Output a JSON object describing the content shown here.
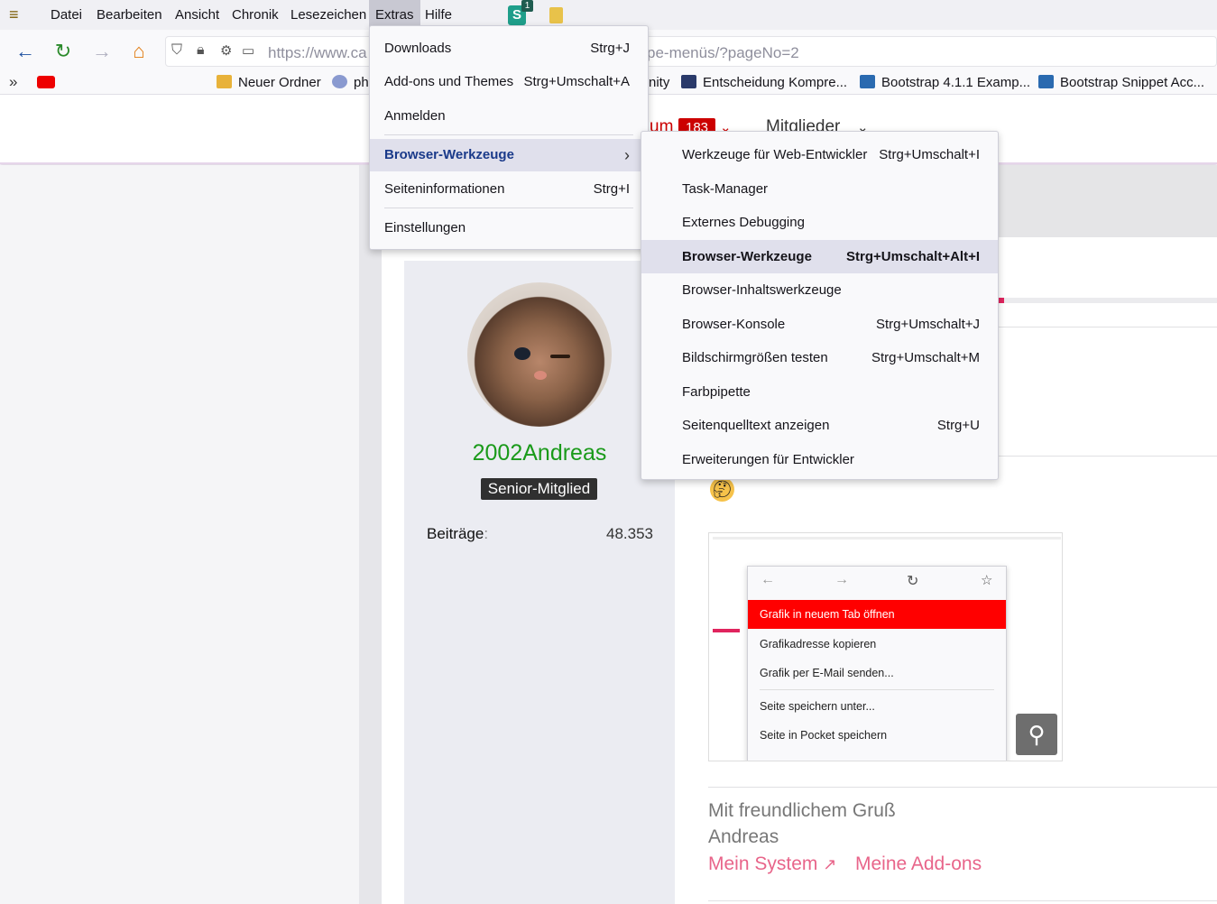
{
  "menubar": {
    "items": [
      "Datei",
      "Bearbeiten",
      "Ansicht",
      "Chronik",
      "Lesezeichen",
      "Extras",
      "Hilfe"
    ],
    "badge": "1"
  },
  "navbar": {
    "url": "https://www.ca",
    "url_tail": "pe-menüs/?pageNo=2"
  },
  "bookmarks": [
    {
      "label": "Neuer Ordner",
      "icon": "folder-icon",
      "color": "#e8b23a"
    },
    {
      "label": "ph",
      "icon": "people-icon",
      "color": "#5a6aa0"
    },
    {
      "label": "nity",
      "icon": "",
      "color": ""
    },
    {
      "label": "Entscheidung Kompre...",
      "icon": "chart-icon",
      "color": "#2a3a6a"
    },
    {
      "label": "Bootstrap 4.1.1 Examp...",
      "icon": "bootstrap-icon",
      "color": "#2a6ab0"
    },
    {
      "label": "Bootstrap Snippet Acc...",
      "icon": "bootstrap-icon",
      "color": "#2a6ab0"
    }
  ],
  "page": {
    "nav_badge": "183",
    "nav_item": "Mitglieder",
    "nav_prev": "um"
  },
  "user": {
    "name": "2002Andreas",
    "rank": "Senior-Mitglied",
    "posts_label": "Beiträge",
    "posts_sep": ":",
    "posts_value": "48.353"
  },
  "screenshot_menu": {
    "items": [
      "Grafik in neuem Tab öffnen",
      "Grafikadresse kopieren",
      "Grafik per E-Mail senden...",
      "Seite speichern unter...",
      "Seite in Pocket speichern"
    ]
  },
  "signature": {
    "line1": "Mit freundlichem Gruß",
    "line2": "Andreas",
    "link1": "Mein System",
    "link2": "Meine Add-ons"
  },
  "extras_menu": {
    "items": [
      {
        "label": "Downloads",
        "shortcut": "Strg+J"
      },
      {
        "label": "Add-ons und Themes",
        "shortcut": "Strg+Umschalt+A"
      },
      {
        "label": "Anmelden",
        "shortcut": ""
      },
      {
        "label": "Browser-Werkzeuge",
        "shortcut": ""
      },
      {
        "label": "Seiteninformationen",
        "shortcut": "Strg+I"
      },
      {
        "label": "Einstellungen",
        "shortcut": ""
      }
    ]
  },
  "submenu": {
    "items": [
      {
        "label": "Werkzeuge für Web-Entwickler",
        "shortcut": "Strg+Umschalt+I"
      },
      {
        "label": "Task-Manager",
        "shortcut": ""
      },
      {
        "label": "Externes Debugging",
        "shortcut": ""
      },
      {
        "label": "Browser-Werkzeuge",
        "shortcut": "Strg+Umschalt+Alt+I"
      },
      {
        "label": "Browser-Inhaltswerkzeuge",
        "shortcut": ""
      },
      {
        "label": "Browser-Konsole",
        "shortcut": "Strg+Umschalt+J"
      },
      {
        "label": "Bildschirmgrößen testen",
        "shortcut": "Strg+Umschalt+M"
      },
      {
        "label": "Farbpipette",
        "shortcut": ""
      },
      {
        "label": "Seitenquelltext anzeigen",
        "shortcut": "Strg+U"
      },
      {
        "label": "Erweiterungen für Entwickler",
        "shortcut": ""
      }
    ]
  }
}
